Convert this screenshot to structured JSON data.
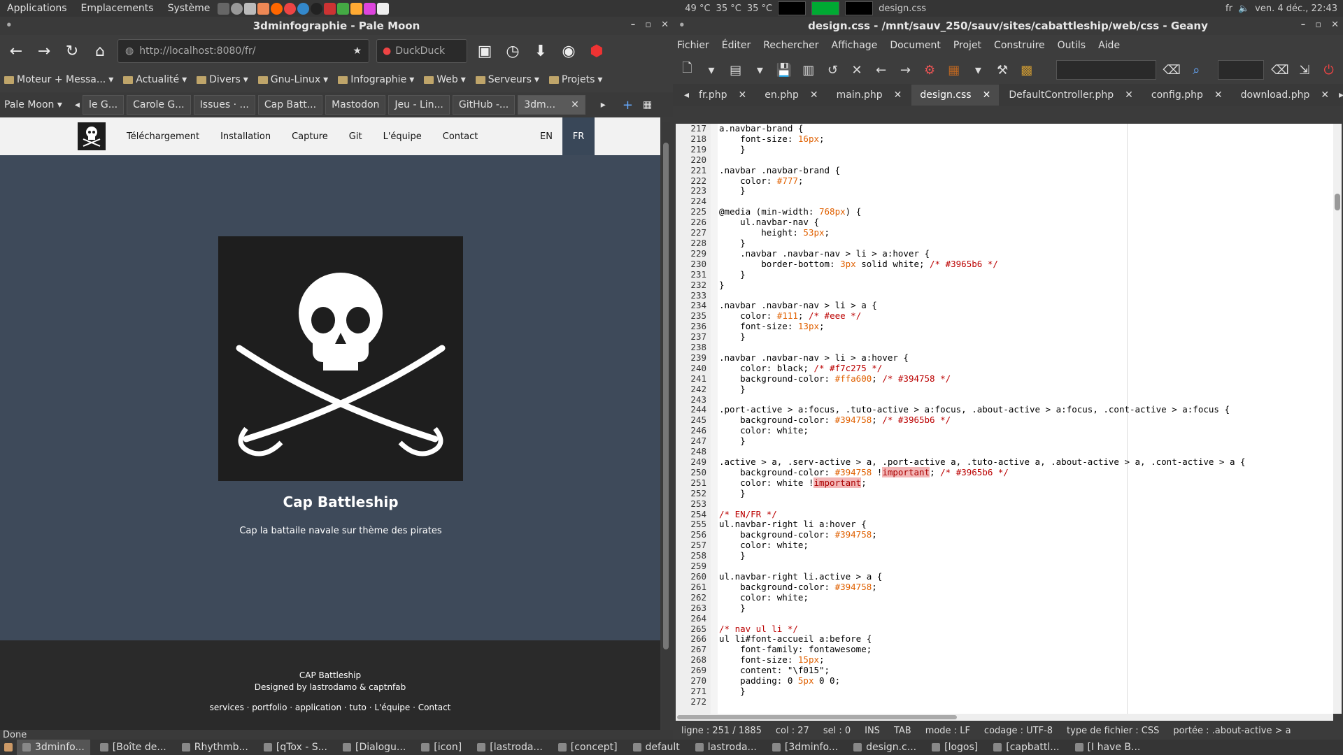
{
  "topbar": {
    "menus": [
      "Applications",
      "Emplacements",
      "Système"
    ],
    "temps": [
      "49 °C",
      "35 °C",
      "35 °C"
    ],
    "lang": "fr",
    "clock": "ven. 4 déc., 22:43"
  },
  "browser": {
    "title": "3dminfographie - Pale Moon",
    "url": "http://localhost:8080/fr/",
    "search_placeholder": "DuckDuck",
    "bookmarks": [
      "Moteur + Messa...",
      "Actualité",
      "Divers",
      "Gnu-Linux",
      "Infographie",
      "Web",
      "Serveurs",
      "Projets"
    ],
    "menu_label": "Pale Moon",
    "tabs": [
      "le G...",
      "Carole G...",
      "Issues · ...",
      "Cap Batt...",
      "Mastodon",
      "Jeu - Lin...",
      "GitHub -...",
      "3dm..."
    ],
    "status": "Done"
  },
  "site": {
    "nav": [
      "Téléchargement",
      "Installation",
      "Capture",
      "Git",
      "L'équipe",
      "Contact"
    ],
    "lang_en": "EN",
    "lang_fr": "FR",
    "title": "Cap Battleship",
    "subtitle": "Cap la battaile navale sur thème des pirates",
    "footer_line1": "CAP Battleship",
    "footer_line2": "Designed by lastrodamo & captnfab",
    "footer_links": "services · portfolio · application · tuto · L'équipe · Contact"
  },
  "editor": {
    "title": "design.css - /mnt/sauv_250/sauv/sites/cabattleship/web/css - Geany",
    "menus": [
      "Fichier",
      "Éditer",
      "Rechercher",
      "Affichage",
      "Document",
      "Projet",
      "Construire",
      "Outils",
      "Aide"
    ],
    "tabs": [
      "fr.php",
      "en.php",
      "main.php",
      "design.css",
      "DefaultController.php",
      "config.php",
      "download.php"
    ],
    "status": {
      "line": "ligne : 251 / 1885",
      "col": "col : 27",
      "sel": "sel : 0",
      "ins": "INS",
      "tab": "TAB",
      "mode": "mode : LF",
      "encoding": "codage : UTF-8",
      "filetype": "type de fichier : CSS",
      "scope": "portée : .about-active > a"
    },
    "line_numbers": [
      "217",
      "218",
      "219",
      "220",
      "221",
      "222",
      "223",
      "224",
      "225",
      "226",
      "227",
      "228",
      "229",
      "230",
      "231",
      "232",
      "233",
      "234",
      "235",
      "236",
      "237",
      "238",
      "239",
      "240",
      "241",
      "242",
      "243",
      "244",
      "245",
      "246",
      "247",
      "248",
      "249",
      "250",
      "251",
      "252",
      "253",
      "254",
      "255",
      "256",
      "257",
      "258",
      "259",
      "260",
      "261",
      "262",
      "263",
      "264",
      "265",
      "266",
      "267",
      "268",
      "269",
      "270",
      "271",
      "272"
    ],
    "code": [
      "a.navbar-brand {",
      "    font-size: 16px;",
      "    }",
      "",
      ".navbar .navbar-brand {",
      "    color: #777;",
      "    }",
      "",
      "@media (min-width: 768px) {",
      "    ul.navbar-nav {",
      "        height: 53px;",
      "    }",
      "    .navbar .navbar-nav > li > a:hover {",
      "        border-bottom: 3px solid white; /* #3965b6 */",
      "    }",
      "}",
      "",
      ".navbar .navbar-nav > li > a {",
      "    color: #111; /* #eee */",
      "    font-size: 13px;",
      "    }",
      "",
      ".navbar .navbar-nav > li > a:hover {",
      "    color: black; /* #f7c275 */",
      "    background-color: #ffa600; /* #394758 */",
      "    }",
      "",
      ".port-active > a:focus, .tuto-active > a:focus, .about-active > a:focus, .cont-active > a:focus {",
      "    background-color: #394758; /* #3965b6 */",
      "    color: white;",
      "    }",
      "",
      ".active > a, .serv-active > a, .port-active a, .tuto-active a, .about-active > a, .cont-active > a {",
      "    background-color: #394758 !important; /* #3965b6 */",
      "    color: white !important;",
      "    }",
      "",
      "/* EN/FR */",
      "ul.navbar-right li a:hover {",
      "    background-color: #394758;",
      "    color: white;",
      "    }",
      "",
      "ul.navbar-right li.active > a {",
      "    background-color: #394758;",
      "    color: white;",
      "    }",
      "",
      "/* nav ul li */",
      "ul li#font-accueil a:before {",
      "    font-family: fontawesome;",
      "    font-size: 15px;",
      "    content: \"\\f015\";",
      "    padding: 0 5px 0 0;",
      "    }",
      ""
    ]
  },
  "taskbar": [
    "3dminfo...",
    "[Boîte de...",
    "Rhythmb...",
    "[qTox - S...",
    "[Dialogu...",
    "[icon]",
    "[lastroda...",
    "[concept]",
    "default",
    "lastroda...",
    "[3dminfo...",
    "design.c...",
    "[logos]",
    "[capbattl...",
    "[I have B..."
  ],
  "colors": {
    "accent": "#394758",
    "nav_hover": "#ffa600",
    "site_bg": "#3e4a5a"
  }
}
